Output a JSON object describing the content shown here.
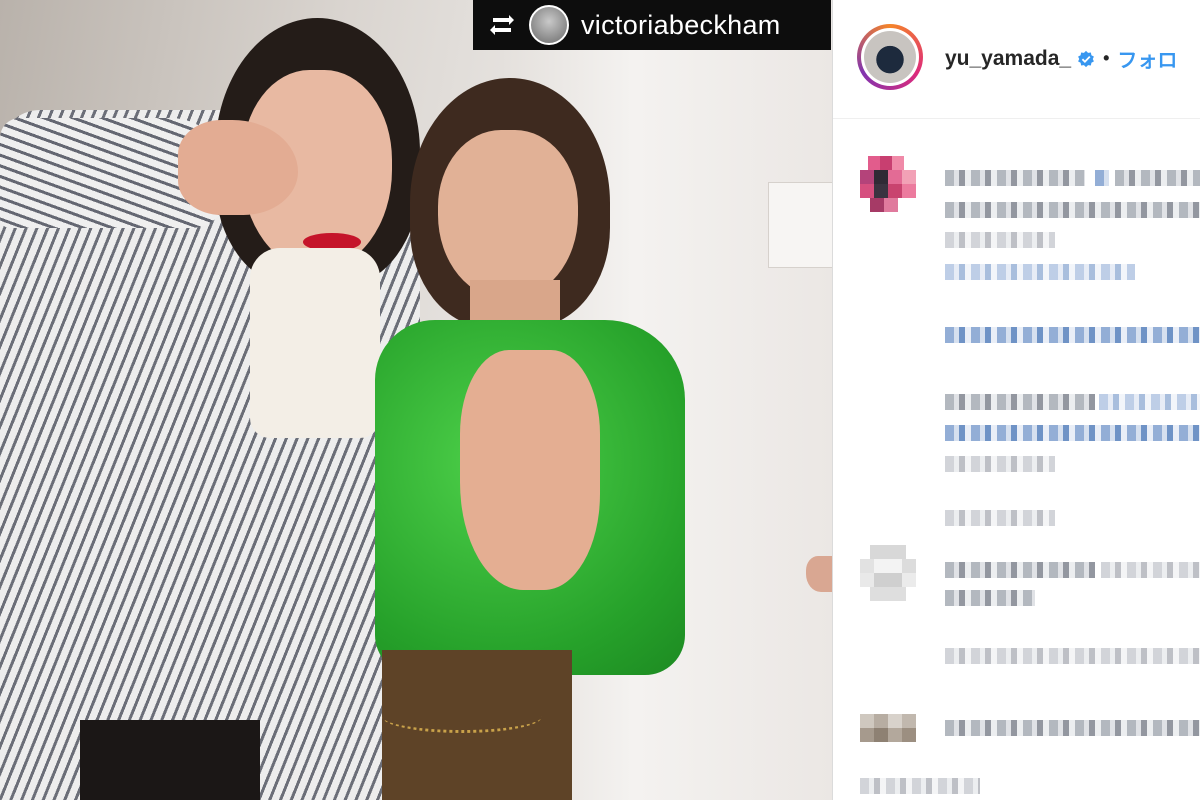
{
  "post": {
    "repost": {
      "username": "victoriabeckham",
      "icon": "repost-icon"
    }
  },
  "header": {
    "username": "yu_yamada_",
    "verified_icon": "verified-badge-icon",
    "separator": "•",
    "follow_label": "フォロ"
  },
  "colors": {
    "follow_blue": "#3897f0",
    "repost_bg": "#0d0d0d",
    "green_top": "#2fb52f"
  }
}
